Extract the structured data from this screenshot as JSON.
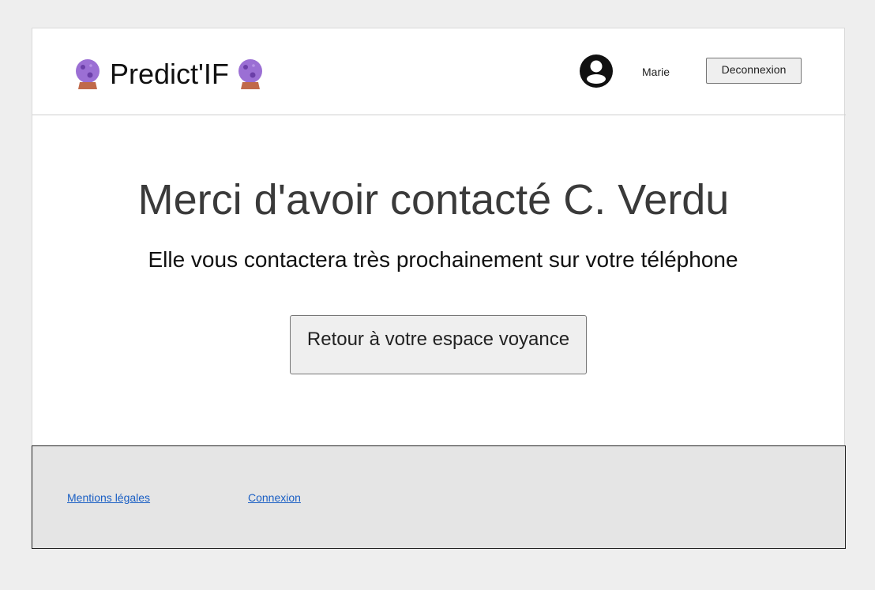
{
  "header": {
    "brand_title": "Predict'IF",
    "brand_icon_left": "crystal-ball-icon",
    "brand_icon_right": "crystal-ball-icon",
    "user_icon": "account-circle-icon",
    "user_name": "Marie",
    "logout_label": "Deconnexion"
  },
  "main": {
    "title": "Merci d'avoir contacté C. Verdu",
    "subtitle": "Elle vous contactera très prochainement sur votre téléphone",
    "back_button_label": "Retour à votre espace voyance"
  },
  "footer": {
    "links": [
      {
        "label": "Mentions légales"
      },
      {
        "label": "Connexion"
      }
    ]
  },
  "colors": {
    "background": "#eeeeee",
    "footer_background": "#e5e5e5",
    "link": "#1a5fc4",
    "orb": "#9b6fd4",
    "orb_base": "#c0694a"
  }
}
